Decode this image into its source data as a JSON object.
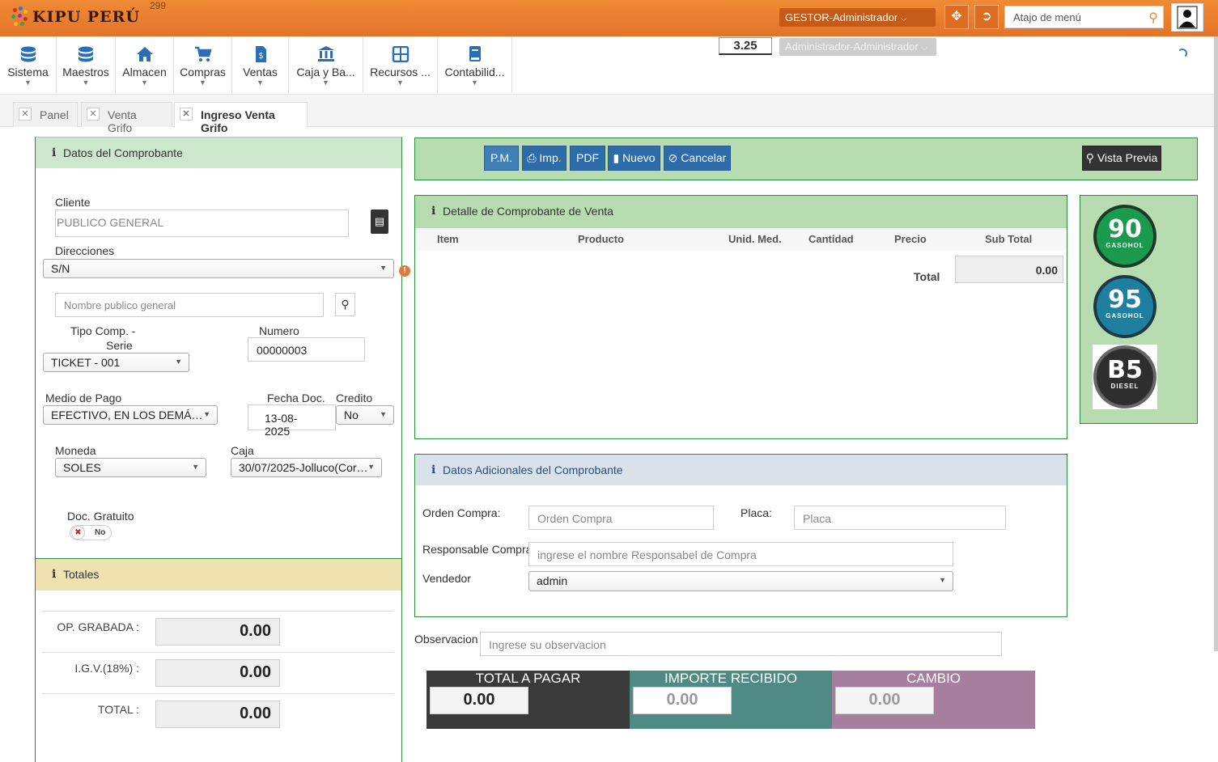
{
  "header": {
    "logo_text": "KIPU PERÚ",
    "counter": "299",
    "role_dropdown": "GESTOR-Administrador",
    "shortcut_placeholder": "Atajo de menú",
    "exchange_rate": "3.25",
    "admin_dropdown": "Administrador-Administrador"
  },
  "menu": {
    "items": [
      {
        "label": "Sistema",
        "icon": "database-icon"
      },
      {
        "label": "Maestros",
        "icon": "database-icon"
      },
      {
        "label": "Almacen",
        "icon": "home-icon"
      },
      {
        "label": "Compras",
        "icon": "cart-icon"
      },
      {
        "label": "Ventas",
        "icon": "invoice-icon"
      },
      {
        "label": "Caja y Ba...",
        "icon": "bank-icon"
      },
      {
        "label": "Recursos ...",
        "icon": "grid-icon"
      },
      {
        "label": "Contabilid...",
        "icon": "book-icon"
      }
    ]
  },
  "tabs": [
    {
      "label": "Panel"
    },
    {
      "label": "Venta Grifo"
    },
    {
      "label": "Ingreso Venta Grifo"
    }
  ],
  "comprobante": {
    "title": "Datos del Comprobante",
    "cliente_label": "Cliente",
    "cliente_value": "PUBLICO GENERAL",
    "direcciones_label": "Direcciones",
    "direccion_value": "S/N",
    "nombre_placeholder": "Nombre publico general",
    "tipo_comp_label_1": "Tipo Comp. -",
    "tipo_comp_label_2": "Serie",
    "tipo_comp_value": "TICKET - 001",
    "numero_label": "Numero",
    "numero_value": "00000003",
    "medio_pago_label": "Medio de Pago",
    "medio_pago_value": "EFECTIVO, EN LOS DEMÁ…",
    "fecha_label": "Fecha Doc.",
    "fecha_value": "13-08-2025",
    "credito_label": "Credito",
    "credito_value": "No",
    "moneda_label": "Moneda",
    "moneda_value": "SOLES",
    "caja_label": "Caja",
    "caja_value": "30/07/2025-Jolluco(Cor…",
    "gratuito_label": "Doc. Gratuito",
    "gratuito_value": "No"
  },
  "totales": {
    "title": "Totales",
    "rows": [
      {
        "label": "OP. GRABADA :",
        "value": "0.00"
      },
      {
        "label": "I.G.V.(18%) :",
        "value": "0.00"
      },
      {
        "label": "TOTAL :",
        "value": "0.00"
      }
    ]
  },
  "toolbar": {
    "pm": "P.M.",
    "imp": "Imp.",
    "pdf": "PDF",
    "nuevo": "Nuevo",
    "cancelar": "Cancelar",
    "vista_previa": "Vista Previa"
  },
  "detalle": {
    "title": "Detalle de Comprobante de Venta",
    "columns": [
      "Item",
      "Producto",
      "Unid. Med.",
      "Cantidad",
      "Precio",
      "Sub Total"
    ],
    "total_label": "Total",
    "total_value": "0.00"
  },
  "fuel": [
    {
      "number": "90",
      "name": "GASOHOL",
      "color": "#1a9a4c"
    },
    {
      "number": "95",
      "name": "GASOHOL",
      "color": "#1f7fa0"
    },
    {
      "number": "B5",
      "name": "DIESEL",
      "color": "#2e2e2e"
    }
  ],
  "adicionales": {
    "title": "Datos Adicionales del Comprobante",
    "orden_label": "Orden Compra:",
    "orden_placeholder": "Orden Compra",
    "placa_label": "Placa:",
    "placa_placeholder": "Placa",
    "responsable_label": "Responsable Compra:",
    "responsable_placeholder": "ingrese el nombre Responsabel de Compra",
    "vendedor_label": "Vendedor",
    "vendedor_value": "admin"
  },
  "observacion": {
    "label": "Observacion",
    "placeholder": "Ingrese su observacion"
  },
  "pagos": {
    "total_label": "TOTAL A PAGAR",
    "total_value": "0.00",
    "importe_label": "IMPORTE RECIBIDO",
    "importe_value": "0.00",
    "cambio_label": "CAMBIO",
    "cambio_value": "0.00"
  }
}
